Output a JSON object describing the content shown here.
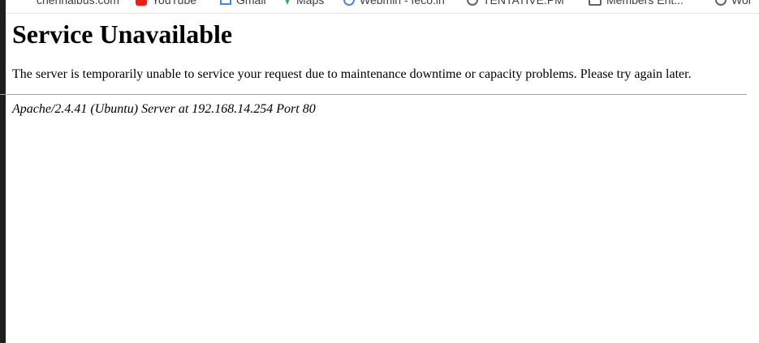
{
  "bookmarks": [
    {
      "label": "chennaibus.com",
      "icon": "globe-icon"
    },
    {
      "label": "YouTube",
      "icon": "youtube-icon"
    },
    {
      "label": "Gmail",
      "icon": "gmail-icon"
    },
    {
      "label": "Maps",
      "icon": "maps-icon"
    },
    {
      "label": "Webmin - feco.in",
      "icon": "webmin-icon"
    },
    {
      "label": "TENTATIVE.PM",
      "icon": "globe-icon"
    },
    {
      "label": "Members Ent...",
      "icon": "book-icon"
    },
    {
      "label": "Wor",
      "icon": "globe-icon"
    }
  ],
  "page": {
    "title": "Service Unavailable",
    "message": "The server is temporarily unable to service your request due to maintenance downtime or capacity problems. Please try again later.",
    "server_signature": "Apache/2.4.41 (Ubuntu) Server at 192.168.14.254 Port 80"
  }
}
